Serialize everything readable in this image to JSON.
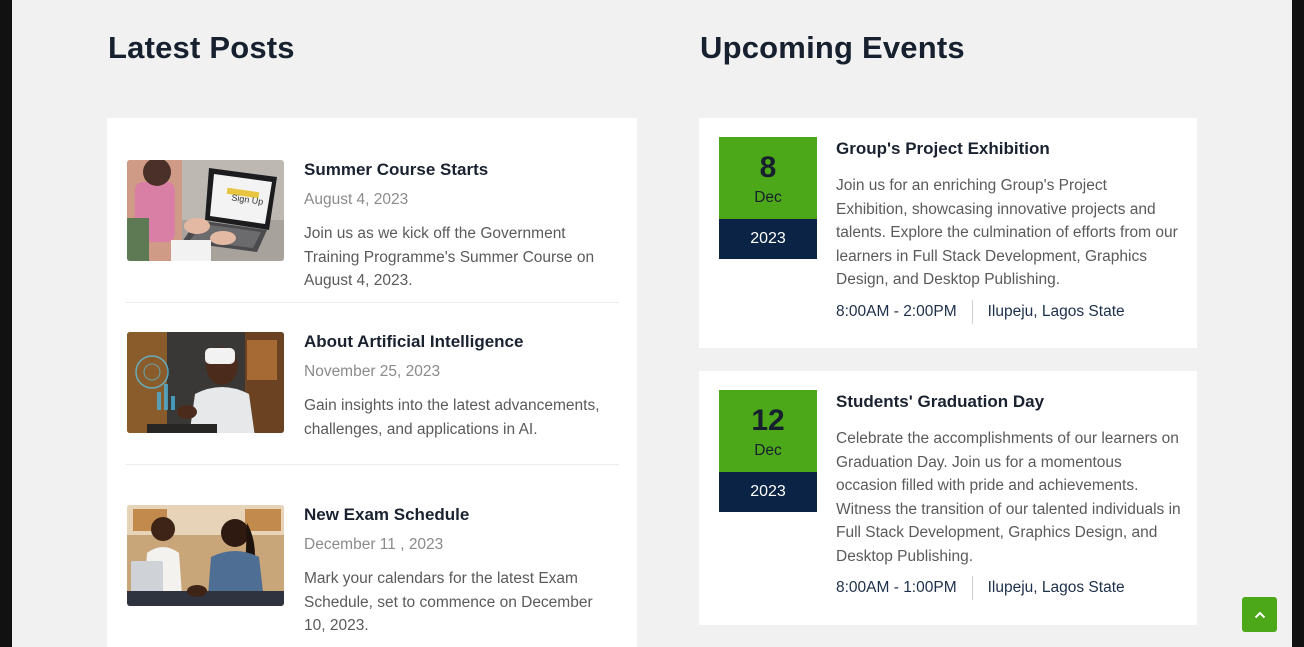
{
  "posts": {
    "title": "Latest Posts",
    "items": [
      {
        "title": "Summer Course Starts",
        "date": "August 4, 2023",
        "excerpt": "Join us as we kick off the Government Training Programme's Summer Course on August 4, 2023."
      },
      {
        "title": "About Artificial Intelligence",
        "date": "November 25, 2023",
        "excerpt": "Gain insights into the latest advancements, challenges, and applications in AI."
      },
      {
        "title": "New Exam Schedule",
        "date": "December 11 , 2023",
        "excerpt": "Mark your calendars for the latest Exam Schedule, set to commence on December 10, 2023."
      }
    ]
  },
  "events": {
    "title": "Upcoming Events",
    "items": [
      {
        "day": "8",
        "month": "Dec",
        "year": "2023",
        "title": "Group's Project Exhibition",
        "description": "Join us for an enriching Group's Project Exhibition, showcasing innovative projects and talents. Explore the culmination of efforts from our learners in Full Stack Development, Graphics Design, and Desktop Publishing.",
        "time": "8:00AM - 2:00PM",
        "location": "Ilupeju, Lagos State"
      },
      {
        "day": "12",
        "month": "Dec",
        "year": "2023",
        "title": "Students' Graduation Day",
        "description": "Celebrate the accomplishments of our learners on Graduation Day. Join us for a momentous occasion filled with pride and achievements. Witness the transition of our talented individuals in Full Stack Development, Graphics Design, and Desktop Publishing.",
        "time": "8:00AM - 1:00PM",
        "location": "Ilupeju, Lagos State"
      }
    ]
  },
  "thumb_text": "Sign Up",
  "colors": {
    "accent": "#4ca719",
    "navy": "#0b2344",
    "page_bg": "#f1f1f1"
  },
  "scroll_top": {
    "icon": "chevron-up-icon"
  }
}
